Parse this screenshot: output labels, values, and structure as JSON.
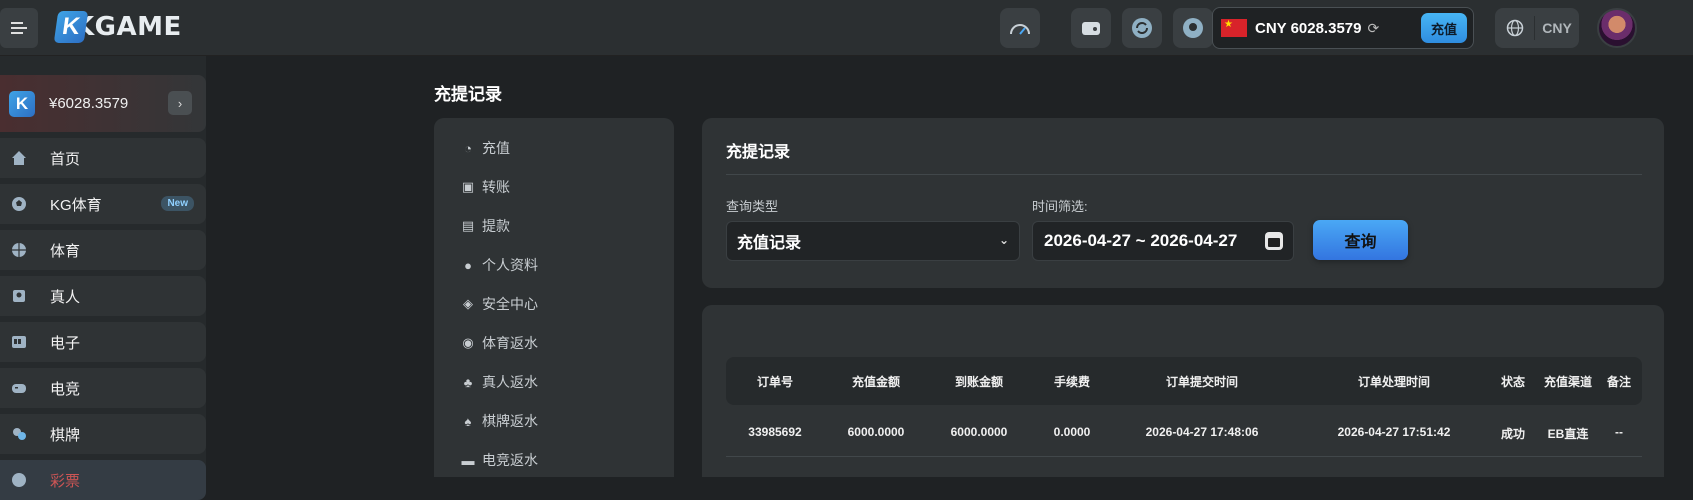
{
  "header": {
    "logo_text": "KGAME",
    "logo_letter": "K",
    "balance_label": "CNY 6028.3579",
    "recharge_label": "充值",
    "currency": "CNY"
  },
  "sidebar": {
    "wallet_amount": "¥6028.3579",
    "wallet_letter": "K",
    "items": [
      {
        "label": "首页",
        "icon": "home-icon"
      },
      {
        "label": "KG体育",
        "icon": "football-icon",
        "badge": "New"
      },
      {
        "label": "体育",
        "icon": "basketball-icon"
      },
      {
        "label": "真人",
        "icon": "live-dealer-icon"
      },
      {
        "label": "电子",
        "icon": "slot-machine-icon"
      },
      {
        "label": "电竞",
        "icon": "gamepad-icon"
      },
      {
        "label": "棋牌",
        "icon": "chess-icon"
      },
      {
        "label": "彩票",
        "icon": "lottery-icon"
      }
    ]
  },
  "page": {
    "title": "充提记录"
  },
  "submenu": {
    "items": [
      {
        "label": "充值",
        "icon": "piggy-bank-icon"
      },
      {
        "label": "转账",
        "icon": "transfer-icon"
      },
      {
        "label": "提款",
        "icon": "withdraw-icon"
      },
      {
        "label": "个人资料",
        "icon": "user-icon"
      },
      {
        "label": "安全中心",
        "icon": "shield-icon"
      },
      {
        "label": "体育返水",
        "icon": "soccer-ball-icon"
      },
      {
        "label": "真人返水",
        "icon": "chips-icon"
      },
      {
        "label": "棋牌返水",
        "icon": "cards-icon"
      },
      {
        "label": "电竞返水",
        "icon": "gamepad-icon"
      }
    ]
  },
  "filter": {
    "title": "充提记录",
    "type_label": "查询类型",
    "type_value": "充值记录",
    "time_label": "时间筛选:",
    "date_range": "2026-04-27 ~ 2026-04-27",
    "query_label": "查询"
  },
  "table": {
    "columns": [
      "订单号",
      "充值金额",
      "到账金额",
      "手续费",
      "订单提交时间",
      "订单处理时间",
      "状态",
      "充值渠道",
      "备注"
    ],
    "rows": [
      [
        "33985692",
        "6000.0000",
        "6000.0000",
        "0.0000",
        "2026-04-27 17:48:06",
        "2026-04-27 17:51:42",
        "成功",
        "EB直连",
        "--"
      ]
    ]
  }
}
